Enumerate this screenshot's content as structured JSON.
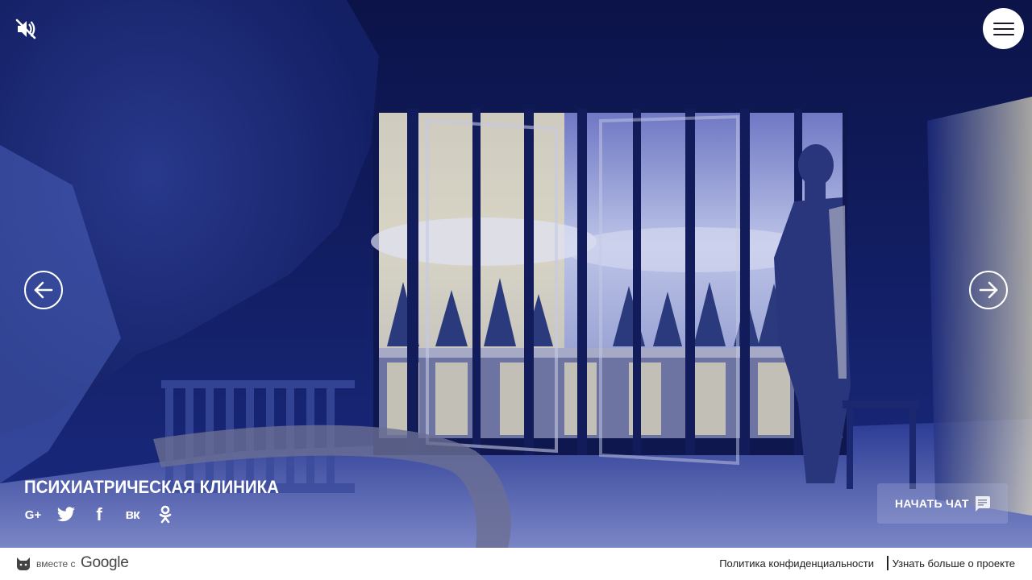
{
  "scene": {
    "title": "ПСИХИАТРИЧЕСКАЯ КЛИНИКА"
  },
  "controls": {
    "mute_icon": "volume-off-icon",
    "menu_icon": "hamburger-menu-icon",
    "prev_icon": "arrow-left-icon",
    "next_icon": "arrow-right-icon"
  },
  "share": [
    {
      "name": "google-plus",
      "glyph": "G+"
    },
    {
      "name": "twitter",
      "glyph": ""
    },
    {
      "name": "facebook",
      "glyph": "f"
    },
    {
      "name": "vk",
      "glyph": "вк"
    },
    {
      "name": "odnoklassniki",
      "glyph": ""
    }
  ],
  "chat": {
    "label": "НАЧАТЬ ЧАТ",
    "icon": "chat-bubble-icon"
  },
  "footer": {
    "with_text": "вместе с",
    "google": "Google",
    "privacy": "Политика конфиденциальности",
    "learn_more": "Узнать больше о проекте"
  },
  "colors": {
    "scene_dark": "#0c1550",
    "scene_mid": "#1f2f86",
    "window_light": "#e8dfb8",
    "white": "#ffffff"
  }
}
